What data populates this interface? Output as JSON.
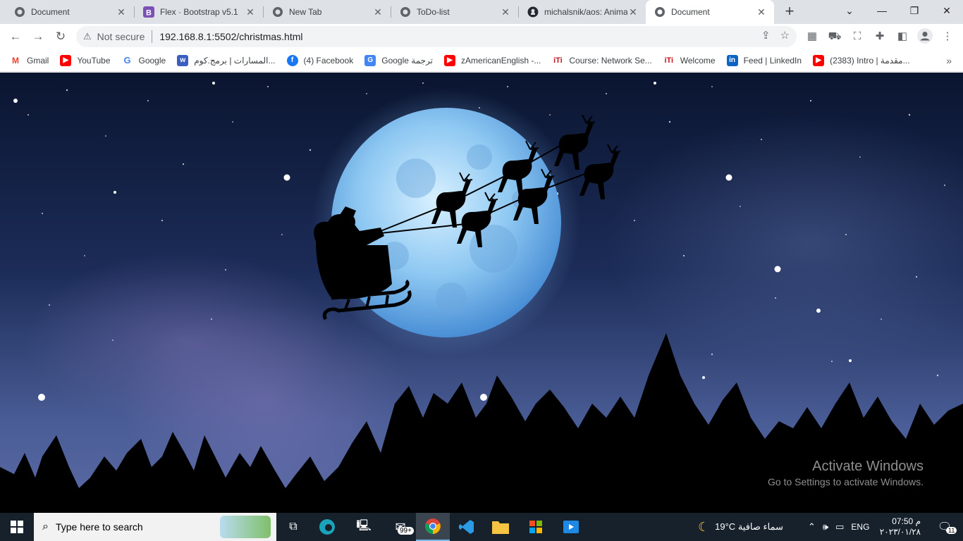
{
  "tabs": [
    {
      "title": "Document",
      "icon": "globe-icon"
    },
    {
      "title": "Flex · Bootstrap v5.1",
      "icon": "bootstrap-icon"
    },
    {
      "title": "New Tab",
      "icon": "globe-icon"
    },
    {
      "title": "ToDo-list",
      "icon": "globe-icon"
    },
    {
      "title": "michalsnik/aos: Anima",
      "icon": "github-icon"
    },
    {
      "title": "Document",
      "icon": "globe-icon",
      "active": true
    }
  ],
  "address": {
    "security_label": "Not secure",
    "url": "192.168.8.1:5502/christmas.html"
  },
  "bookmarks": [
    {
      "label": "Gmail",
      "icon": "gmail-icon",
      "color": "#ea4335"
    },
    {
      "label": "YouTube",
      "icon": "youtube-icon",
      "color": "#ff0000"
    },
    {
      "label": "Google",
      "icon": "google-icon",
      "color": "#4285f4"
    },
    {
      "label": "المسارات | برمج.كوم...",
      "icon": "bookmark-site-icon",
      "color": "#3b5fc0"
    },
    {
      "label": "(4) Facebook",
      "icon": "facebook-icon",
      "color": "#1877f2"
    },
    {
      "label": "Google ترجمة",
      "icon": "translate-icon",
      "color": "#4285f4"
    },
    {
      "label": "zAmericanEnglish -...",
      "icon": "youtube-icon",
      "color": "#ff0000"
    },
    {
      "label": "Course: Network Se...",
      "icon": "iti-icon",
      "color": "#c4161c"
    },
    {
      "label": "Welcome",
      "icon": "iti-icon",
      "color": "#c4161c"
    },
    {
      "label": "Feed | LinkedIn",
      "icon": "linkedin-icon",
      "color": "#0a66c2"
    },
    {
      "label": "(2383) Intro | مقدمة...",
      "icon": "youtube-icon",
      "color": "#ff0000"
    }
  ],
  "watermark": {
    "title": "Activate Windows",
    "subtitle": "Go to Settings to activate Windows."
  },
  "taskbar": {
    "search_placeholder": "Type here to search",
    "mail_badge": "99+",
    "weather": "19°C  سماء صافية",
    "language": "ENG",
    "time": "07:50 م",
    "date": "٢٠٢٣/٠١/٢٨",
    "notification_count": "11"
  }
}
